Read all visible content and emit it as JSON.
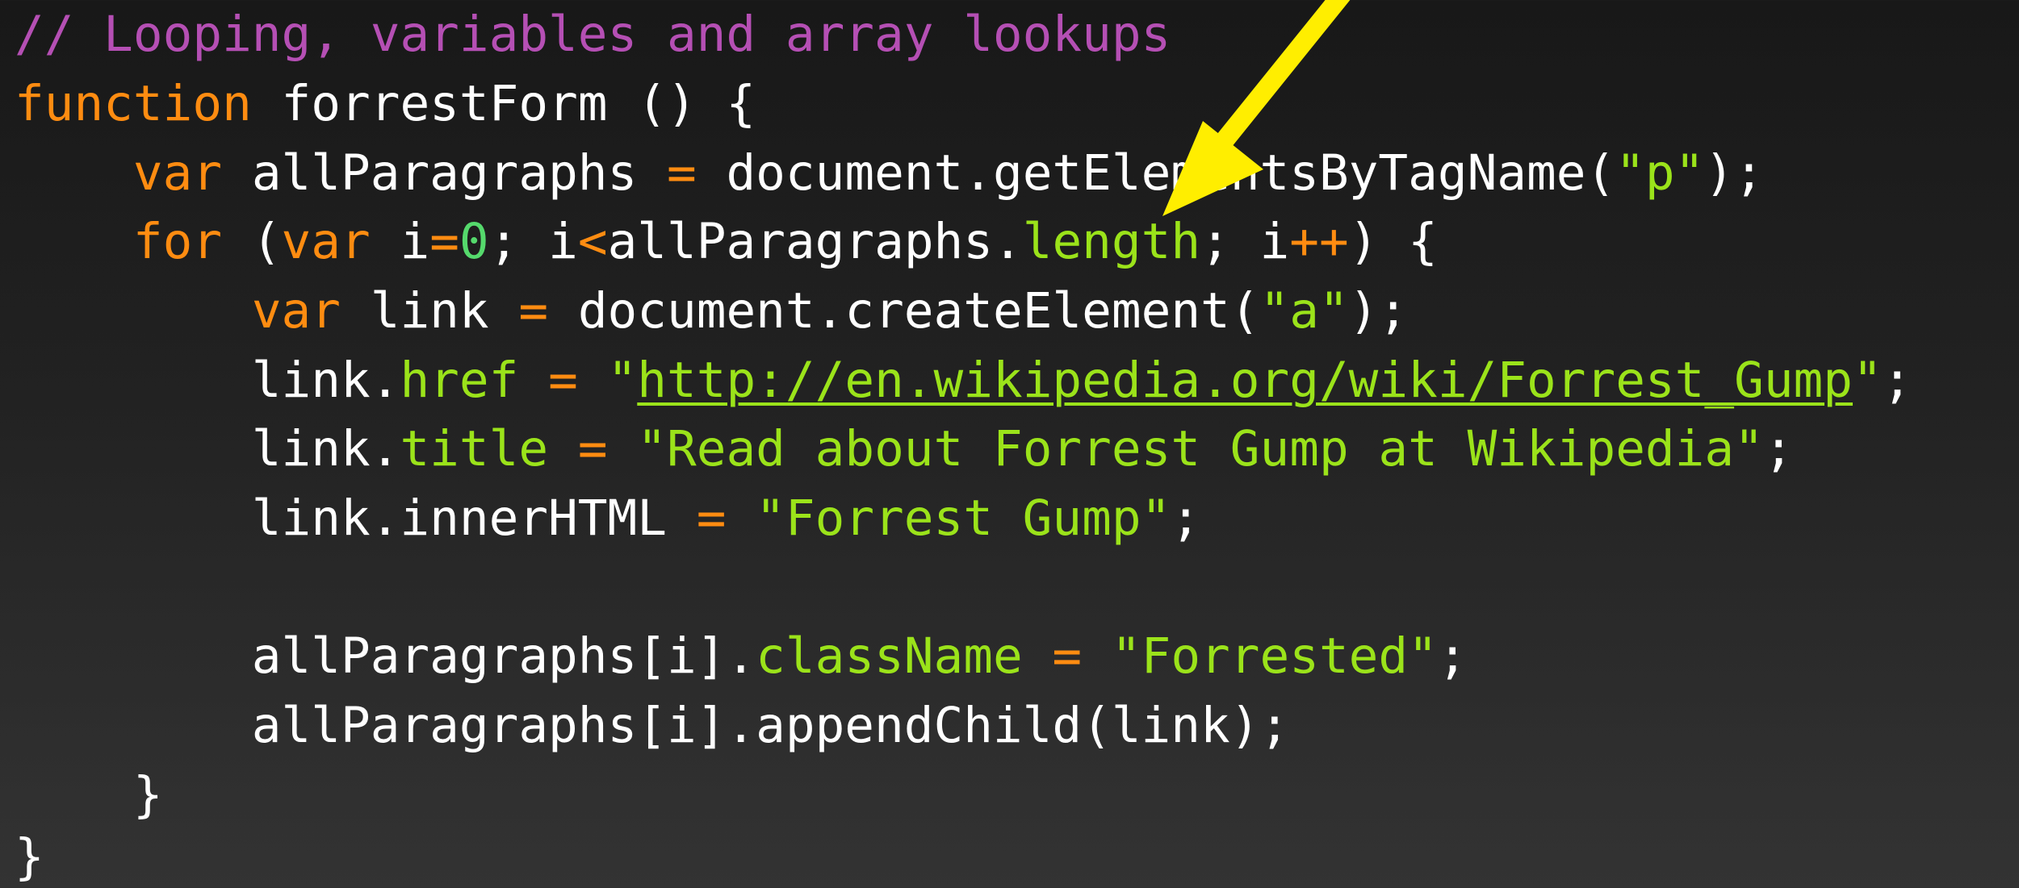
{
  "annotation": {
    "arrow_color": "#ffee00",
    "arrow_icon": "arrow-pointer-icon"
  },
  "colors": {
    "background": "#1e1e1e",
    "comment": "#b54fb4",
    "keyword": "#ff8c11",
    "string": "#9be31a",
    "number": "#55d96c",
    "text": "#ffffff"
  },
  "code": {
    "lines": [
      [
        {
          "t": "// Looping, variables and array lookups",
          "k": "comment"
        }
      ],
      [
        {
          "t": "function",
          "k": "keyword"
        },
        {
          "t": " forrestForm () {",
          "k": "plain"
        }
      ],
      [
        {
          "t": "    ",
          "k": "plain"
        },
        {
          "t": "var",
          "k": "keyword"
        },
        {
          "t": " allParagraphs ",
          "k": "plain"
        },
        {
          "t": "=",
          "k": "op"
        },
        {
          "t": " document.getElementsByTagName(",
          "k": "plain"
        },
        {
          "t": "\"p\"",
          "k": "string"
        },
        {
          "t": ");",
          "k": "plain"
        }
      ],
      [
        {
          "t": "    ",
          "k": "plain"
        },
        {
          "t": "for",
          "k": "keyword"
        },
        {
          "t": " (",
          "k": "plain"
        },
        {
          "t": "var",
          "k": "keyword"
        },
        {
          "t": " i",
          "k": "plain"
        },
        {
          "t": "=",
          "k": "op"
        },
        {
          "t": "0",
          "k": "number"
        },
        {
          "t": "; i",
          "k": "plain"
        },
        {
          "t": "<",
          "k": "op"
        },
        {
          "t": "allParagraphs.",
          "k": "plain"
        },
        {
          "t": "length",
          "k": "prop"
        },
        {
          "t": "; i",
          "k": "plain"
        },
        {
          "t": "++",
          "k": "op"
        },
        {
          "t": ") {",
          "k": "plain"
        }
      ],
      [
        {
          "t": "        ",
          "k": "plain"
        },
        {
          "t": "var",
          "k": "keyword"
        },
        {
          "t": " link ",
          "k": "plain"
        },
        {
          "t": "=",
          "k": "op"
        },
        {
          "t": " document.createElement(",
          "k": "plain"
        },
        {
          "t": "\"a\"",
          "k": "string"
        },
        {
          "t": ");",
          "k": "plain"
        }
      ],
      [
        {
          "t": "        link.",
          "k": "plain"
        },
        {
          "t": "href",
          "k": "prop"
        },
        {
          "t": " ",
          "k": "plain"
        },
        {
          "t": "=",
          "k": "op"
        },
        {
          "t": " ",
          "k": "plain"
        },
        {
          "t": "\"",
          "k": "string"
        },
        {
          "t": "http://en.wikipedia.org/wiki/Forrest_Gump",
          "k": "url"
        },
        {
          "t": "\"",
          "k": "string"
        },
        {
          "t": ";",
          "k": "plain"
        }
      ],
      [
        {
          "t": "        link.",
          "k": "plain"
        },
        {
          "t": "title",
          "k": "prop"
        },
        {
          "t": " ",
          "k": "plain"
        },
        {
          "t": "=",
          "k": "op"
        },
        {
          "t": " ",
          "k": "plain"
        },
        {
          "t": "\"Read about Forrest Gump at Wikipedia\"",
          "k": "string"
        },
        {
          "t": ";",
          "k": "plain"
        }
      ],
      [
        {
          "t": "        link.innerHTML ",
          "k": "plain"
        },
        {
          "t": "=",
          "k": "op"
        },
        {
          "t": " ",
          "k": "plain"
        },
        {
          "t": "\"Forrest Gump\"",
          "k": "string"
        },
        {
          "t": ";",
          "k": "plain"
        }
      ],
      [],
      [
        {
          "t": "        allParagraphs[i].",
          "k": "plain"
        },
        {
          "t": "className",
          "k": "prop"
        },
        {
          "t": " ",
          "k": "plain"
        },
        {
          "t": "=",
          "k": "op"
        },
        {
          "t": " ",
          "k": "plain"
        },
        {
          "t": "\"Forrested\"",
          "k": "string"
        },
        {
          "t": ";",
          "k": "plain"
        }
      ],
      [
        {
          "t": "        allParagraphs[i].appendChild(link);",
          "k": "plain"
        }
      ],
      [
        {
          "t": "    }",
          "k": "plain"
        }
      ],
      [
        {
          "t": "}",
          "k": "plain"
        }
      ]
    ]
  }
}
